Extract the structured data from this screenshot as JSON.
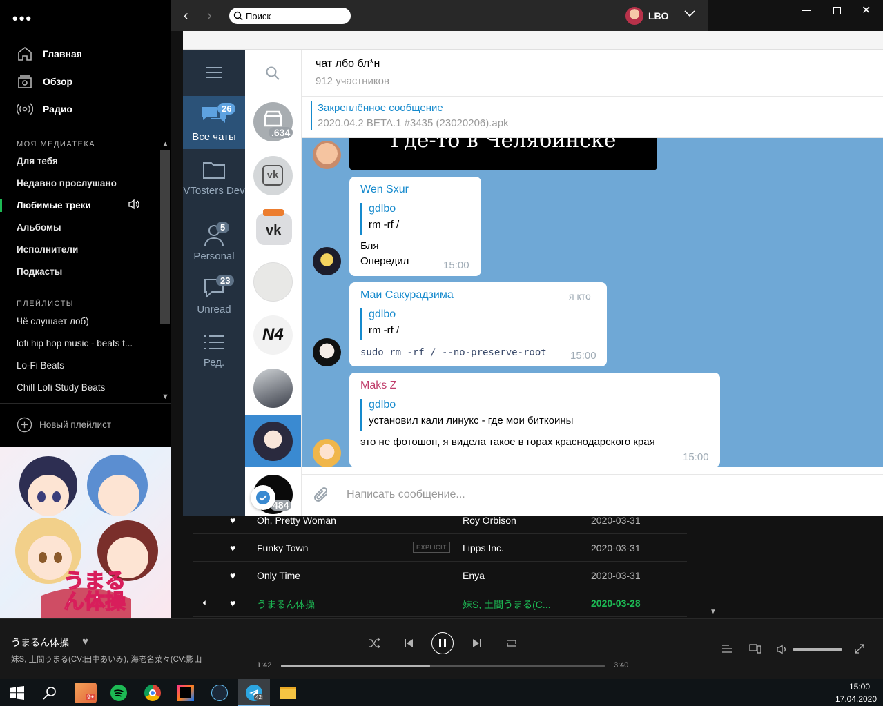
{
  "spotify": {
    "nav": [
      {
        "label": "Главная",
        "icon": "home-icon"
      },
      {
        "label": "Обзор",
        "icon": "browse-icon"
      },
      {
        "label": "Радио",
        "icon": "radio-icon"
      }
    ],
    "library_header": "МОЯ МЕДИАТЕКА",
    "library": [
      "Для тебя",
      "Недавно прослушано",
      "Любимые треки",
      "Альбомы",
      "Исполнители",
      "Подкасты"
    ],
    "playlists_header": "ПЛЕЙЛИСТЫ",
    "playlists": [
      "Чё слушает лоб)",
      "lofi hip hop music - beats t...",
      "Lo-Fi Beats",
      "Chill Lofi Study Beats"
    ],
    "new_playlist": "Новый плейлист",
    "tracks": [
      {
        "title": "Oh, Pretty Woman",
        "artist": "Roy Orbison",
        "date": "2020-03-31",
        "explicit": ""
      },
      {
        "title": "Funky Town",
        "artist": "Lipps Inc.",
        "date": "2020-03-31",
        "explicit": "EXPLICIT"
      },
      {
        "title": "Only Time",
        "artist": "Enya",
        "date": "2020-03-31",
        "explicit": ""
      },
      {
        "title": "うまるん体操",
        "artist": "妹S, 土間うまる(C...",
        "date": "2020-03-28",
        "explicit": ""
      }
    ],
    "now_playing": {
      "title": "うまるん体操",
      "artist": "妹S, 土間うまる(CV:田中あいみ), 海老名菜々(CV:影山",
      "elapsed": "1:42",
      "total": "3:40",
      "progress": 0.46
    },
    "album_text": "うまるん体操",
    "accent": "#1db954"
  },
  "telegram": {
    "search_placeholder": "Поиск",
    "profile_name": "LBO",
    "folders": [
      {
        "label": "Все чаты",
        "badge": "26"
      },
      {
        "label": "VTosters Dev",
        "badge": ""
      },
      {
        "label": "Personal",
        "badge": "5"
      },
      {
        "label": "Unread",
        "badge": "23"
      },
      {
        "label": "Ред.",
        "badge": ""
      }
    ],
    "chat_badges": [
      ".634",
      "484"
    ],
    "chat": {
      "title": "чат лбо бл*н",
      "members": "912 участников"
    },
    "pinned": {
      "label": "Закреплённое сообщение",
      "text": "2020.04.2 BETA.1 #3435 (23020206).apk"
    },
    "image_caption": "Где-то в Челябинске",
    "messages": [
      {
        "author": "Wen Sxur",
        "quote_author": "gdlbo",
        "quote_text": "rm -rf /",
        "lines": [
          "Бля",
          "Опередил"
        ],
        "time": "15:00",
        "tag": ""
      },
      {
        "author": "Маи Сакурадзима",
        "quote_author": "gdlbo",
        "quote_text": "rm -rf /",
        "lines": [
          "sudo rm -rf / --no-preserve-root"
        ],
        "time": "15:00",
        "tag": "я кто"
      },
      {
        "author": "Maks Z",
        "quote_author": "gdlbo",
        "quote_text": "установил кали линукс - где мои биткоины",
        "lines": [
          "это не фотошоп, я видела такое в горах краснодарского края"
        ],
        "time": "15:00",
        "tag": ""
      }
    ],
    "input_placeholder": "Написать сообщение..."
  },
  "taskbar": {
    "time": "15:00",
    "date": "17.04.2020",
    "badges": [
      "9+",
      "42"
    ]
  }
}
